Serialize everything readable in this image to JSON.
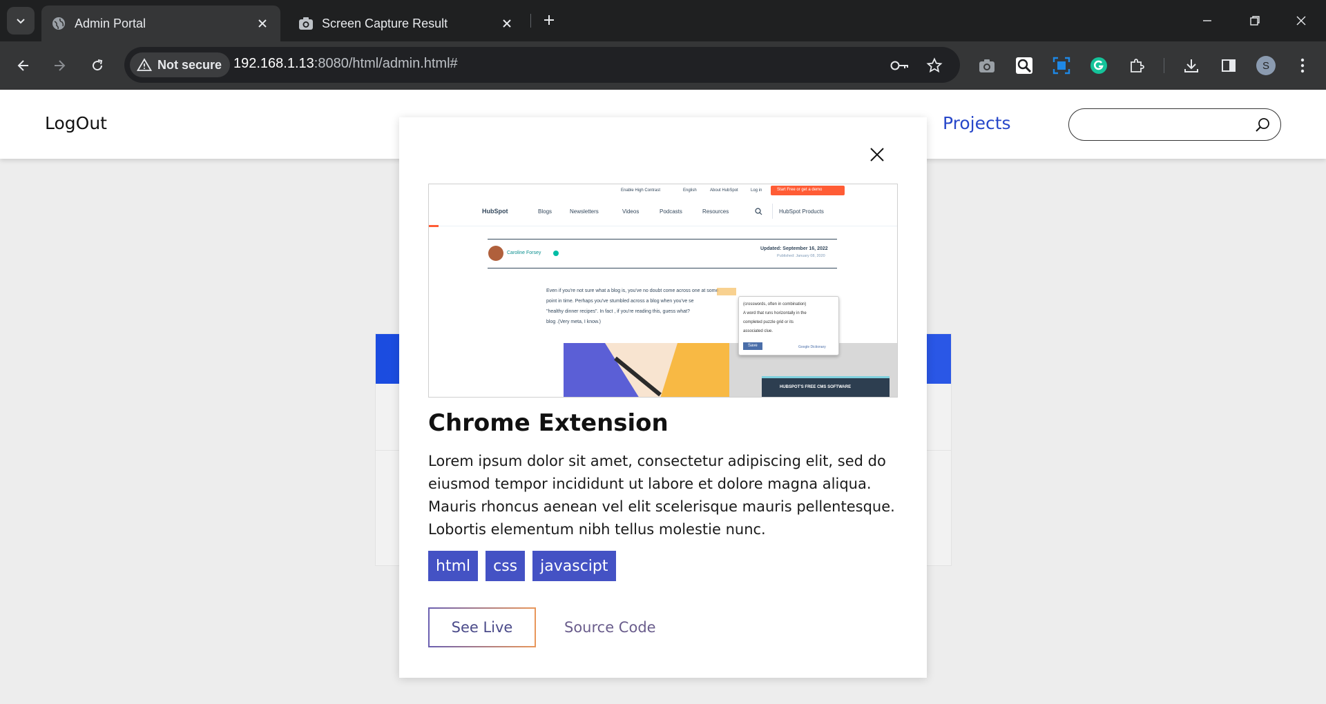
{
  "browser": {
    "tabs": [
      {
        "title": "Admin Portal",
        "active": true,
        "icon": "globe-icon"
      },
      {
        "title": "Screen Capture Result",
        "active": false,
        "icon": "camera-icon"
      }
    ],
    "security_label": "Not secure",
    "url_host": "192.168.1.13",
    "url_path": ":8080/html/admin.html#",
    "profile_initial": "S"
  },
  "navbar": {
    "logout_label": "LogOut",
    "projects_label": "Projects",
    "search_placeholder": ""
  },
  "modal": {
    "title": "Chrome Extension",
    "description": "Lorem ipsum dolor sit amet, consectetur adipiscing elit, sed do eiusmod tempor incididunt ut labore et dolore magna aliqua. Mauris rhoncus aenean vel elit scelerisque mauris pellentesque. Lobortis elementum nibh tellus molestie nunc.",
    "tags": [
      "html",
      "css",
      "javascipt"
    ],
    "see_live_label": "See Live",
    "source_code_label": "Source Code"
  },
  "preview": {
    "top_links": [
      "Enable High Contrast",
      "English",
      "About HubSpot",
      "Log in"
    ],
    "cta": "Start Free or get a demo",
    "logo": "HubSpot",
    "nav": [
      "Blogs",
      "Newsletters",
      "Videos",
      "Podcasts",
      "Resources",
      "HubSpot Products"
    ],
    "author": "Caroline Forsey",
    "updated": "Updated: September 16, 2022",
    "published": "Published: January 08, 2020",
    "body_lines": [
      "Even if you're not sure what a blog is, you've no doubt come across one at some",
      "point in time. Perhaps you've stumbled across a blog when you've se",
      "\"healthy dinner recipes\". In fact , if you're reading this, guess what?",
      "blog .(Very meta, I know.)"
    ],
    "dict_lines": [
      "(crosswords, often in combination)",
      "A word that runs horizontally in the",
      "completed puzzle grid or its",
      "associated clue."
    ],
    "dict_save": "Save",
    "dict_source": "Google Dictionary",
    "cms_banner": "HUBSPOT'S FREE CMS SOFTWARE"
  },
  "colors": {
    "accent_blue": "#2747c9",
    "tag_bg": "#4452c4",
    "hubspot_orange": "#ff5c35"
  }
}
